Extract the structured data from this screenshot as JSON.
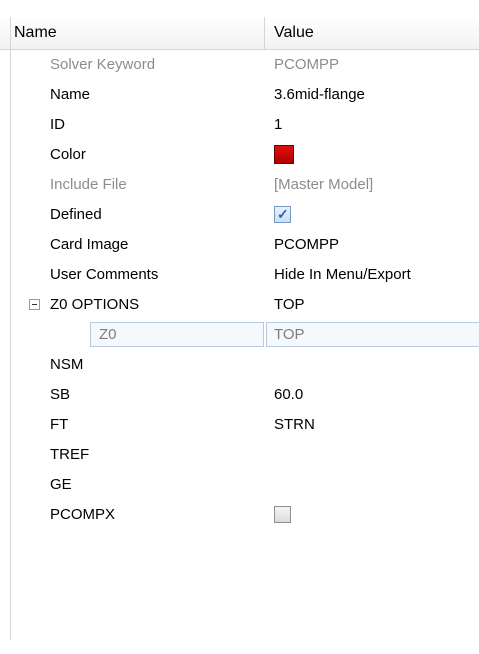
{
  "header": {
    "name_label": "Name",
    "value_label": "Value"
  },
  "colors": {
    "swatch": "#e01010",
    "accent": "#2a66b5"
  },
  "rows": [
    {
      "name": "Solver Keyword",
      "value": "PCOMPP"
    },
    {
      "name": "Name",
      "value": "3.6mid-flange"
    },
    {
      "name": "ID",
      "value": "1"
    },
    {
      "name": "Color",
      "value_type": "color-swatch"
    },
    {
      "name": "Include File",
      "value": "[Master Model]"
    },
    {
      "name": "Defined",
      "value_type": "checkbox",
      "checked": true
    },
    {
      "name": "Card Image",
      "value": "PCOMPP"
    },
    {
      "name": "User Comments",
      "value": "Hide In Menu/Export"
    },
    {
      "name": "Z0 OPTIONS",
      "value": "TOP",
      "expander": "minus-icon"
    },
    {
      "name": "Z0",
      "value": "TOP"
    },
    {
      "name": "NSM",
      "value": ""
    },
    {
      "name": "SB",
      "value": "60.0"
    },
    {
      "name": "FT",
      "value": "STRN"
    },
    {
      "name": "TREF",
      "value": ""
    },
    {
      "name": "GE",
      "value": ""
    },
    {
      "name": "PCOMPX",
      "value_type": "checkbox",
      "checked": false
    }
  ]
}
